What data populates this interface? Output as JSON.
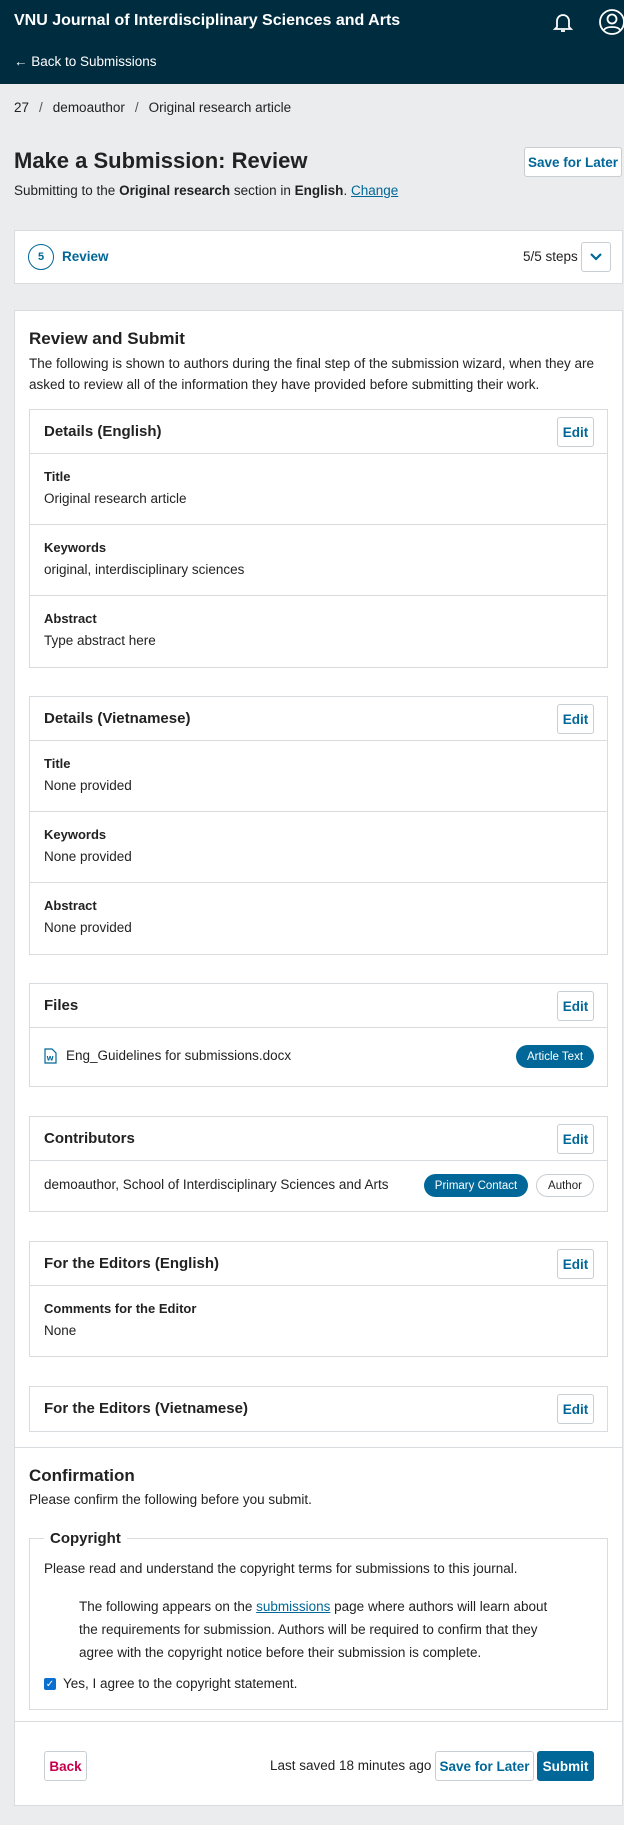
{
  "topbar": {
    "journal_name": "VNU Journal of Interdisciplinary Sciences and Arts",
    "back_link": "← Back to Submissions",
    "bell_icon": "bell-icon",
    "user_icon": "user-avatar-icon"
  },
  "breadcrumb": {
    "id": "27",
    "author": "demoauthor",
    "article": "Original research article"
  },
  "page": {
    "title": "Make a Submission: Review",
    "subtitle_prefix": "Submitting to the ",
    "section": "Original research",
    "subtitle_mid": " section in ",
    "language": "English",
    "subtitle_end": ". ",
    "change_link": "Change",
    "save_later": "Save for Later"
  },
  "steps": {
    "number": "5",
    "label": "Review",
    "count": "5/5 steps",
    "toggle_icon": "chevron-down-icon"
  },
  "review": {
    "heading": "Review and Submit",
    "intro": "The following is shown to authors during the final step of the submission wizard, when they are asked to review all of the information they have provided before submitting their work.",
    "edit_label": "Edit",
    "details_en": {
      "heading": "Details (English)",
      "title_label": "Title",
      "title_value": "Original research article",
      "keywords_label": "Keywords",
      "keywords_value": "original, interdisciplinary sciences",
      "abstract_label": "Abstract",
      "abstract_value": "Type abstract here"
    },
    "details_vi": {
      "heading": "Details (Vietnamese)",
      "title_label": "Title",
      "title_value": "None provided",
      "keywords_label": "Keywords",
      "keywords_value": "None provided",
      "abstract_label": "Abstract",
      "abstract_value": "None provided"
    },
    "files": {
      "heading": "Files",
      "file_name": "Eng_Guidelines for submissions.docx",
      "file_type": "Article Text",
      "file_icon": "word-document-icon"
    },
    "contributors": {
      "heading": "Contributors",
      "entry": "demoauthor, School of Interdisciplinary Sciences and Arts",
      "badge_primary": "Primary Contact",
      "badge_role": "Author"
    },
    "editors_en": {
      "heading": "For the Editors (English)",
      "comments_label": "Comments for the Editor",
      "comments_value": "None"
    },
    "editors_vi": {
      "heading": "For the Editors (Vietnamese)"
    }
  },
  "confirmation": {
    "heading": "Confirmation",
    "intro": "Please confirm the following before you submit.",
    "copyright_legend": "Copyright",
    "copyright_text": "Please read and understand the copyright terms for submissions to this journal.",
    "notice_prefix": "The following appears on the ",
    "notice_link": "submissions",
    "notice_suffix": " page where authors will learn about the requirements for submission. Authors will be required to confirm that they agree with the copyright notice before their submission is complete.",
    "agree_label": "Yes, I agree to the copyright statement.",
    "agree_checked": true
  },
  "footer": {
    "back": "Back",
    "last_saved": "Last saved 18 minutes ago",
    "save_later": "Save for Later",
    "submit": "Submit"
  },
  "colors": {
    "header_bg": "#002c40",
    "accent": "#006798",
    "back_red": "#c8004b"
  }
}
